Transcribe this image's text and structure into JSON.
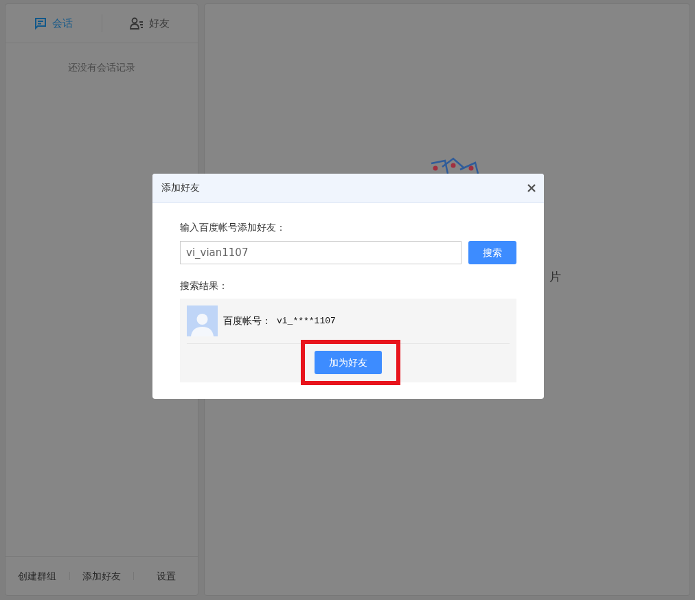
{
  "sidebar": {
    "tabs": [
      {
        "label": "会话",
        "kind": "chat",
        "selected": true
      },
      {
        "label": "好友",
        "kind": "contacts",
        "selected": false
      }
    ],
    "empty_text": "还没有会话记录",
    "footer_links": [
      "创建群组",
      "添加好友",
      "设置"
    ]
  },
  "main": {
    "empty_text": "片"
  },
  "dialog": {
    "title": "添加好友",
    "prompt": "输入百度帐号添加好友：",
    "input_value": "vi_vian1107",
    "search_button": "搜索",
    "result_label": "搜索结果：",
    "result": {
      "account_label": "百度帐号：",
      "account": "vi_****1107"
    },
    "add_button": {
      "label": "加为好友",
      "highlighted": true
    }
  }
}
